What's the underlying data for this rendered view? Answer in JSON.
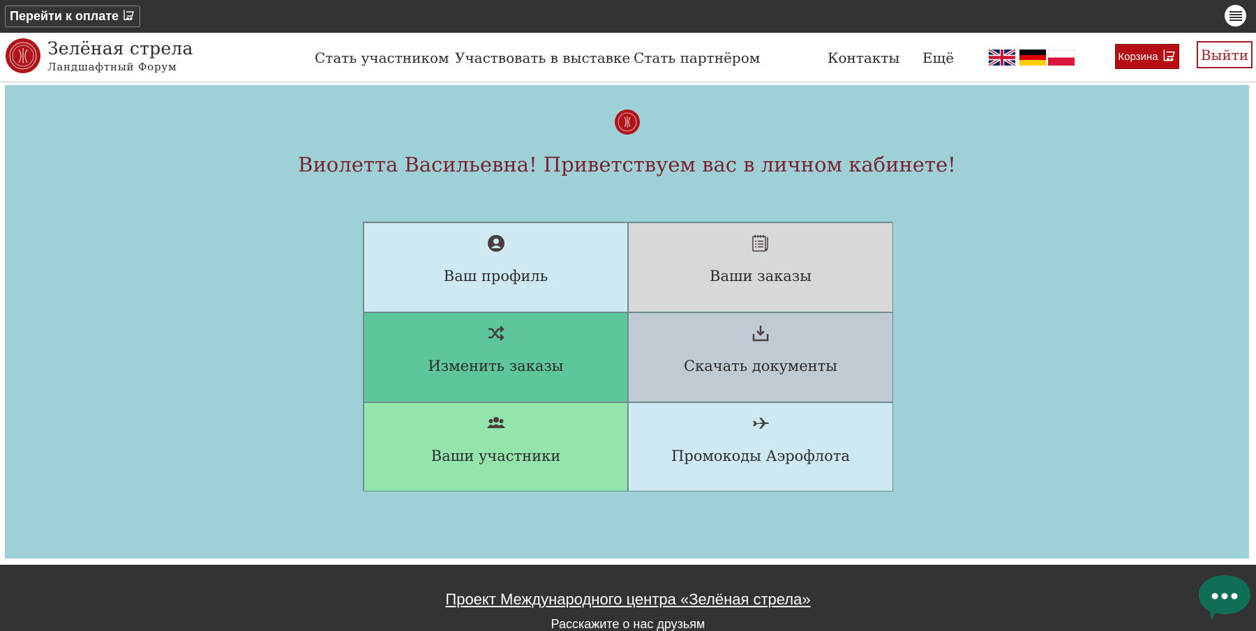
{
  "topbar": {
    "pay_label": "Перейти к оплате",
    "pay_icon": "cart-icon",
    "menu_icon": "hamburger-menu-icon"
  },
  "header": {
    "brand_title": "Зелёная стрела",
    "brand_subtitle": "Ландшафтный Форум",
    "nav": {
      "become_participant": "Стать участником",
      "exhibit": "Участвовать в выставке",
      "become_partner": "Стать партнёром",
      "contacts": "Контакты",
      "more": "Ещё"
    },
    "languages": [
      "English",
      "Deutsch",
      "Polski"
    ],
    "cart_label": "Корзина",
    "logout_label": "Выйти"
  },
  "main": {
    "greeting": "Виолетта Васильевна! Приветствуем вас в личном кабинете!",
    "tiles": [
      {
        "label": "Ваш профиль",
        "icon": "user-circle-icon",
        "color": "#cfe9f2"
      },
      {
        "label": "Ваши заказы",
        "icon": "notepad-icon",
        "color": "#d8d8d8"
      },
      {
        "label": "Изменить заказы",
        "icon": "shuffle-icon",
        "color": "#5dc69a"
      },
      {
        "label": "Скачать документы",
        "icon": "download-icon",
        "color": "#c0cad3"
      },
      {
        "label": "Ваши участники",
        "icon": "users-icon",
        "color": "#93e5ac"
      },
      {
        "label": "Промокоды Аэрофлота",
        "icon": "airplane-icon",
        "color": "#cfe9f2"
      }
    ]
  },
  "footer": {
    "project_link": "Проект Международного центра «Зелёная стрела»",
    "share_text": "Расскажите о нас друзьям",
    "chat_icon": "chat-bubble-icon"
  },
  "colors": {
    "dark_bar": "#333333",
    "main_bg": "#9dd1d7",
    "accent_red": "#b50d12",
    "greeting_text": "#7a2430"
  }
}
